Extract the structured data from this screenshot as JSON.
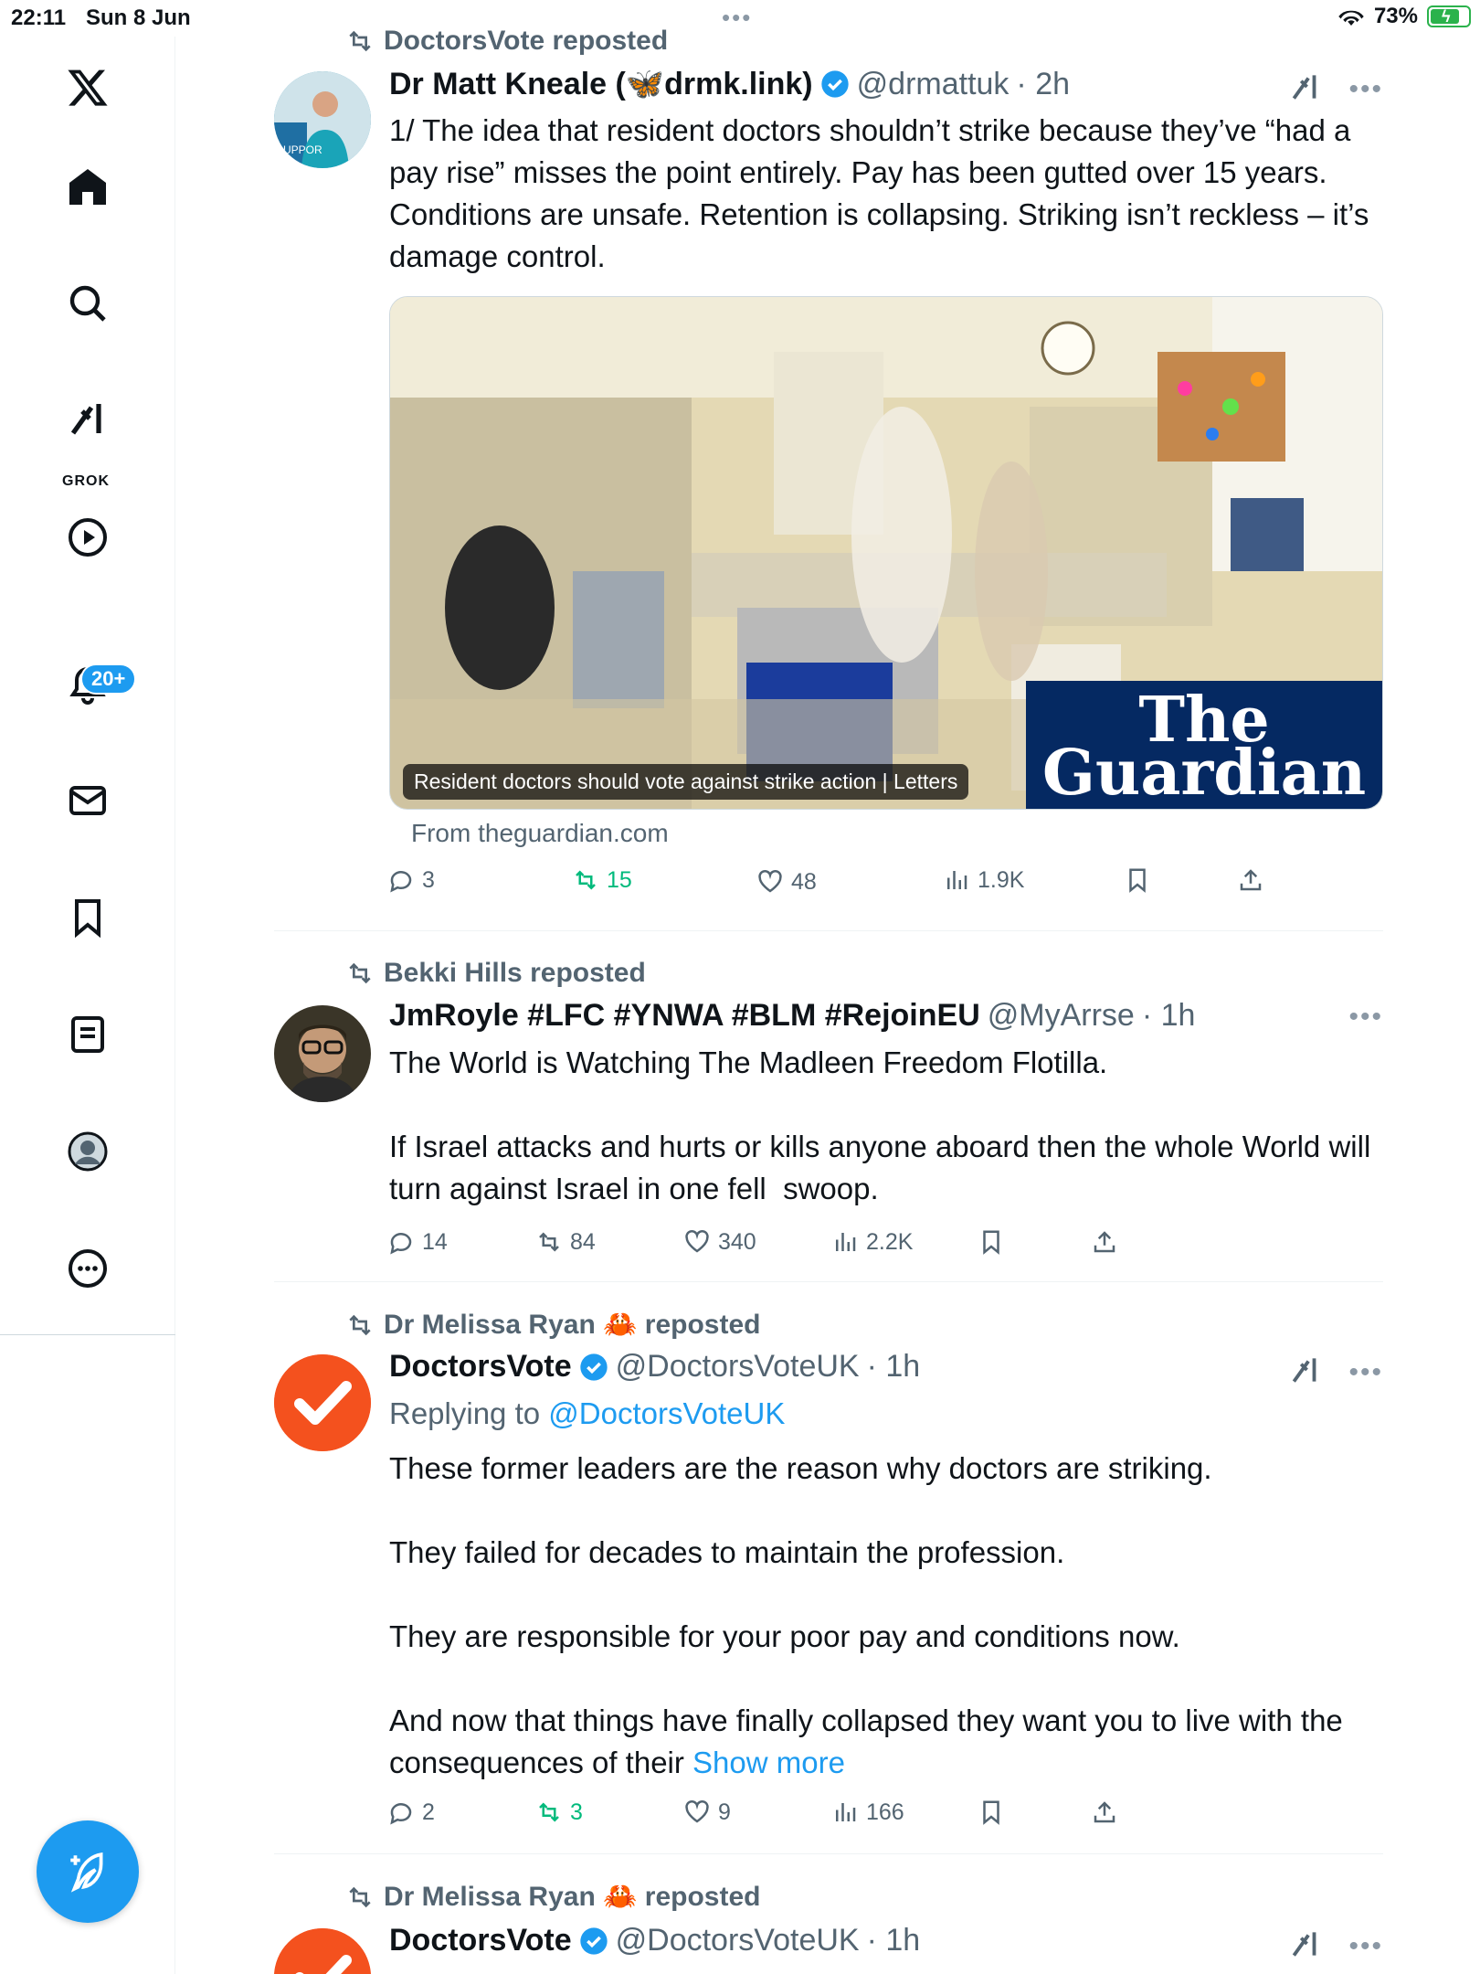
{
  "status_bar": {
    "time": "22:11",
    "date": "Sun 8 Jun",
    "battery": "73%"
  },
  "sidebar": {
    "notification_badge": "20+",
    "grok_label": "GROK",
    "items": [
      "home-icon",
      "search-icon",
      "grok-icon",
      "video-icon",
      "notifications-icon",
      "messages-icon",
      "bookmarks-icon",
      "lists-icon",
      "profile-icon",
      "more-icon"
    ]
  },
  "colors": {
    "accent": "#1d9bf0",
    "repost_green": "#00ba7c",
    "secondary_text": "#536471",
    "guardian_blue": "#052962"
  },
  "posts": [
    {
      "reposted_by": "DoctorsVote reposted",
      "name": "Dr Matt Kneale (🦋drmk.link)",
      "handle": "@drmattuk",
      "time": "· 2h",
      "text": "1/ The idea that resident doctors shouldn’t strike because they’ve “had a pay rise” misses the point entirely. Pay has been gutted over 15 years. Conditions are unsafe. Retention is collapsing. Striking isn’t reckless – it’s damage control.",
      "card": {
        "caption": "Resident doctors should vote against strike action | Letters",
        "logo_line1": "The",
        "logo_line2": "Guardian",
        "source": "From theguardian.com"
      },
      "stats": {
        "replies": "3",
        "reposts": "15",
        "likes": "48",
        "views": "1.9K"
      }
    },
    {
      "reposted_by": "Bekki Hills reposted",
      "name": "JmRoyle #LFC #YNWA #BLM #RejoinEU",
      "handle": "@MyArrse",
      "time": "· 1h",
      "text": "The World is Watching The Madleen Freedom Flotilla.\n\nIf Israel attacks and hurts or kills anyone aboard then the whole World will turn against Israel in one fell  swoop.",
      "stats": {
        "replies": "14",
        "reposts": "84",
        "likes": "340",
        "views": "2.2K"
      }
    },
    {
      "reposted_by": "Dr Melissa Ryan 🦀 reposted",
      "name": "DoctorsVote",
      "handle": "@DoctorsVoteUK",
      "time": "· 1h",
      "replying_prefix": "Replying to ",
      "replying_handle": "@DoctorsVoteUK",
      "text": "These former leaders are the reason why doctors are striking.\n\nThey failed for decades to maintain the profession.\n\nThey are responsible for your poor pay and conditions now.\n\nAnd now that things have finally collapsed they want you to live with the consequences of their ",
      "show_more": "Show more",
      "stats": {
        "replies": "2",
        "reposts": "3",
        "likes": "9",
        "views": "166"
      }
    },
    {
      "reposted_by": "Dr Melissa Ryan 🦀 reposted",
      "name": "DoctorsVote",
      "handle": "@DoctorsVoteUK",
      "time": "· 1h"
    }
  ]
}
